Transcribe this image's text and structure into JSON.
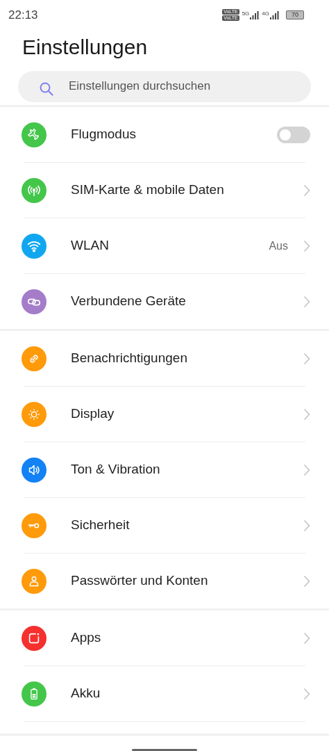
{
  "status_bar": {
    "time": "22:13",
    "volte": [
      "VoLTE",
      "VoLTE"
    ],
    "networks": [
      "5G",
      "4G"
    ],
    "battery": "70"
  },
  "title": "Einstellungen",
  "search": {
    "placeholder": "Einstellungen durchsuchen"
  },
  "groups": [
    {
      "items": [
        {
          "kind": "toggle",
          "label": "Flugmodus",
          "color": "#44c64a",
          "on": false
        },
        {
          "kind": "link",
          "label": "SIM-Karte & mobile Daten",
          "color": "#44c64a"
        },
        {
          "kind": "link",
          "label": "WLAN",
          "color": "#10a7f0",
          "value": "Aus"
        },
        {
          "kind": "link",
          "label": "Verbundene Geräte",
          "color": "#a47cc9"
        }
      ]
    },
    {
      "items": [
        {
          "kind": "link",
          "label": "Benachrichtigungen",
          "color": "#ff9a0a"
        },
        {
          "kind": "link",
          "label": "Display",
          "color": "#ff9a0a"
        },
        {
          "kind": "link",
          "label": "Ton & Vibration",
          "color": "#1282f5"
        },
        {
          "kind": "link",
          "label": "Sicherheit",
          "color": "#ff9a0a"
        },
        {
          "kind": "link",
          "label": "Passwörter und Konten",
          "color": "#ff9a0a"
        }
      ]
    },
    {
      "items": [
        {
          "kind": "link",
          "label": "Apps",
          "color": "#f5302e"
        },
        {
          "kind": "link",
          "label": "Akku",
          "color": "#44c64a"
        }
      ]
    }
  ]
}
